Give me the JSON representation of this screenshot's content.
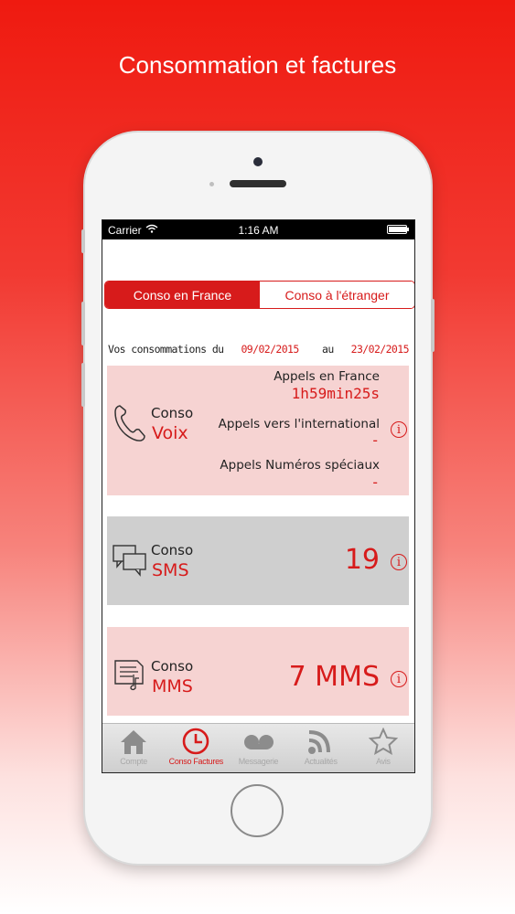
{
  "headline": "Consommation et factures",
  "status_bar": {
    "carrier": "Carrier",
    "time": "1:16 AM"
  },
  "segments": [
    {
      "label": "Conso en France",
      "selected": true
    },
    {
      "label": "Conso à l'étranger",
      "selected": false
    }
  ],
  "period": {
    "prefix": "Vos consommations du",
    "start": "09/02/2015",
    "middle": "au",
    "end": "23/02/2015"
  },
  "voix": {
    "title": "Conso",
    "type": "Voix",
    "rows": [
      {
        "label": "Appels en France",
        "value": "1h59min25s"
      },
      {
        "label": "Appels vers l'international",
        "value": "-"
      },
      {
        "label": "Appels Numéros spéciaux",
        "value": "-"
      }
    ]
  },
  "sms": {
    "title": "Conso",
    "type": "SMS",
    "value": "19"
  },
  "mms": {
    "title": "Conso",
    "type": "MMS",
    "value": "7 MMS"
  },
  "info_glyph": "i",
  "tabs": [
    {
      "label": "Compte",
      "icon": "home-icon",
      "active": false
    },
    {
      "label": "Conso Factures",
      "icon": "clock-icon",
      "active": true
    },
    {
      "label": "Messagerie",
      "icon": "voicemail-icon",
      "active": false
    },
    {
      "label": "Actualités",
      "icon": "rss-icon",
      "active": false
    },
    {
      "label": "Avis",
      "icon": "star-icon",
      "active": false
    }
  ],
  "colors": {
    "accent": "#d71b1b",
    "card_pink": "#f6d3d2",
    "card_gray": "#cfcfcf"
  }
}
